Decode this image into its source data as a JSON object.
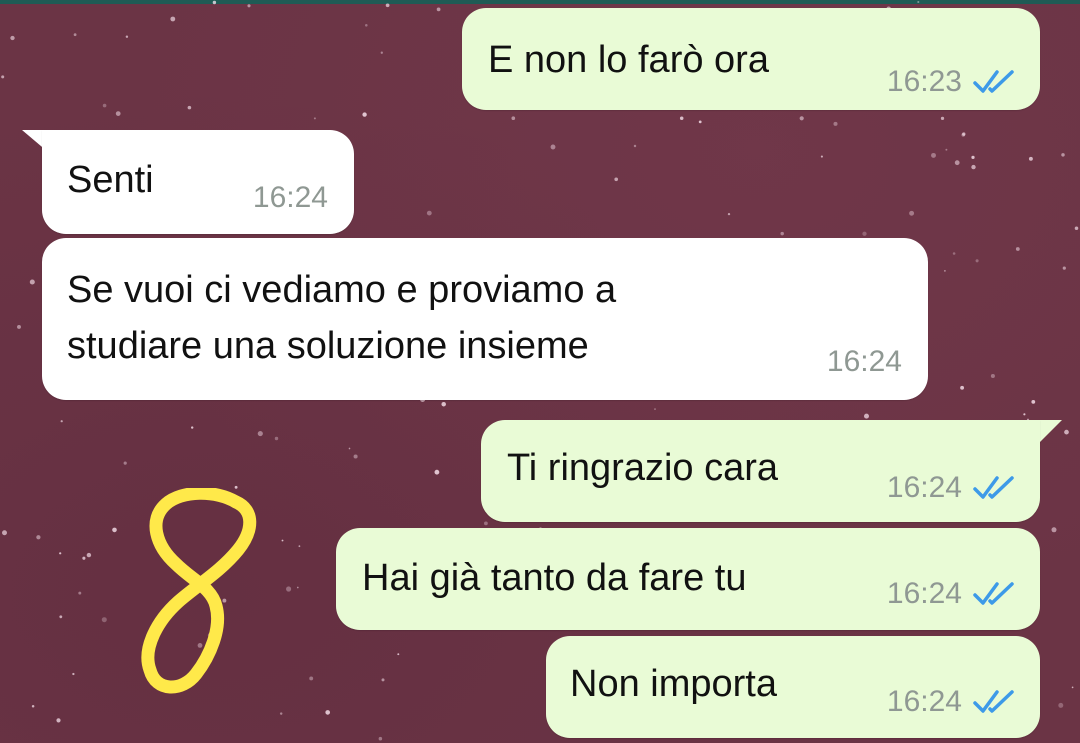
{
  "chat": {
    "messages": [
      {
        "direction": "out",
        "text": "E non lo farò ora",
        "time": "16:23",
        "status": "read"
      },
      {
        "direction": "in",
        "text": "Senti",
        "time": "16:24"
      },
      {
        "direction": "in",
        "lines": [
          "Se vuoi ci vediamo e proviamo a",
          "studiare una soluzione insieme"
        ],
        "time": "16:24"
      },
      {
        "direction": "out",
        "text": "Ti ringrazio cara",
        "time": "16:24",
        "status": "read"
      },
      {
        "direction": "out",
        "text": "Hai già tanto da fare tu",
        "time": "16:24",
        "status": "read"
      },
      {
        "direction": "out",
        "text": "Non importa",
        "time": "16:24",
        "status": "read"
      }
    ]
  },
  "annotation": {
    "label": "8",
    "color": "#ffe94a"
  },
  "colors": {
    "background": "#6b3445",
    "outgoing_bubble": "#e9fbd6",
    "incoming_bubble": "#ffffff",
    "read_ticks": "#3d9ae8",
    "timestamp": "#8f9893"
  },
  "icons": {
    "read_receipt": "double-check-icon"
  }
}
